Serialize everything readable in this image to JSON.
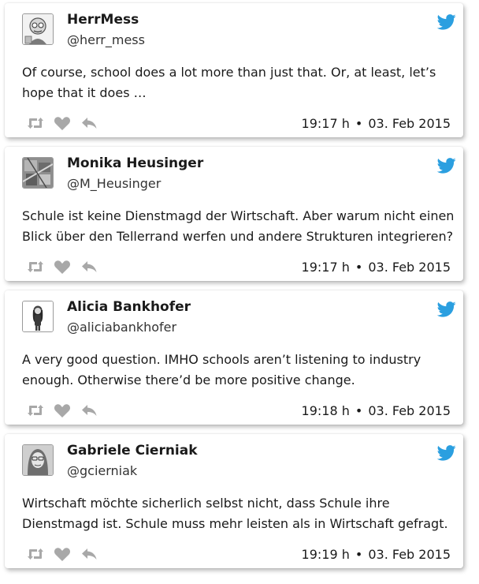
{
  "colors": {
    "twitter_blue": "#2b9fe0",
    "action_gray": "#a8a8a8"
  },
  "icons": {
    "brand": "twitter-bird-icon",
    "retweet": "retweet-icon",
    "like": "heart-icon",
    "reply": "reply-icon"
  },
  "tweets": [
    {
      "name": "HerrMess",
      "handle": "@herr_mess",
      "text": "Of course, school does a lot more than just that. Or, at least, let’s hope that it does …",
      "time": "19:17 h",
      "separator": "•",
      "date": "03. Feb 2015"
    },
    {
      "name": "Monika Heusinger",
      "handle": "@M_Heusinger",
      "text": "Schule ist keine Dienstmagd der Wirtschaft. Aber warum nicht einen Blick über den Tellerrand werfen und andere Strukturen integrieren?",
      "time": "19:17 h",
      "separator": "•",
      "date": "03. Feb 2015"
    },
    {
      "name": "Alicia Bankhofer",
      "handle": "@aliciabankhofer",
      "text": "A very good question. IMHO schools aren’t listening to industry enough. Otherwise there’d be more positive change.",
      "time": "19:18 h",
      "separator": "•",
      "date": "03. Feb 2015"
    },
    {
      "name": "Gabriele Cierniak",
      "handle": "@gcierniak",
      "text": "Wirtschaft möchte sicherlich selbst nicht, dass Schule ihre Dienstmagd ist. Schule muss mehr leisten als in Wirtschaft gefragt.",
      "time": "19:19 h",
      "separator": "•",
      "date": "03. Feb 2015"
    }
  ]
}
